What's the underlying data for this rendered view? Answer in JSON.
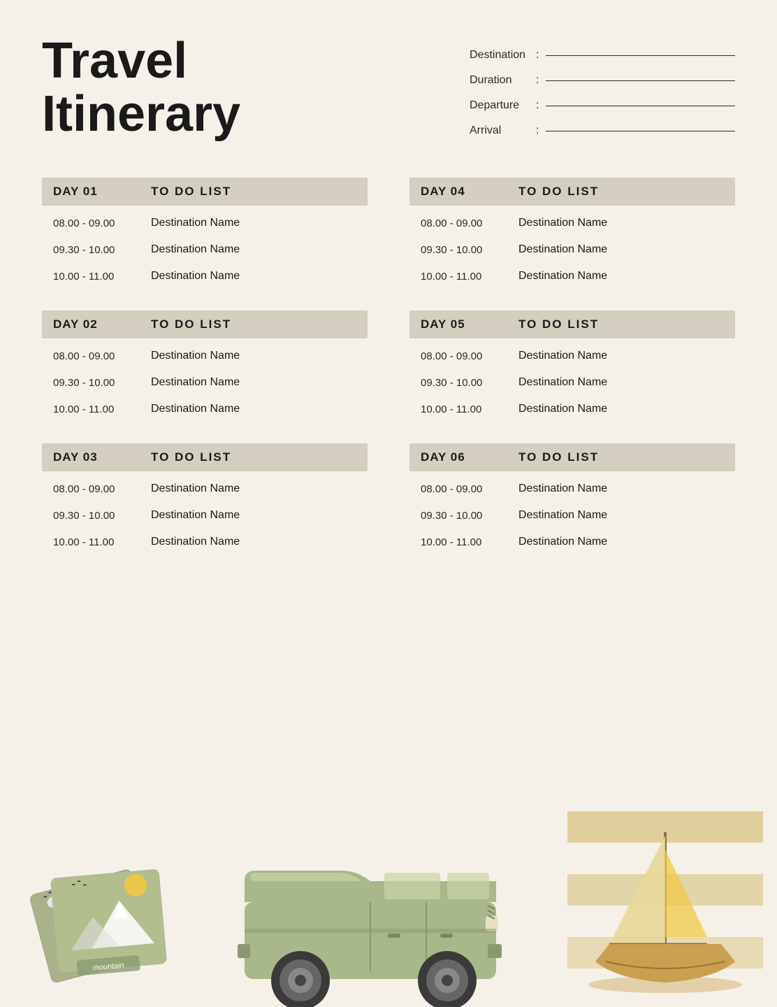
{
  "header": {
    "title_line1": "Travel",
    "title_line2": "Itinerary",
    "fields": [
      {
        "label": "Destination",
        "value": ""
      },
      {
        "label": "Duration",
        "value": ""
      },
      {
        "label": "Departure",
        "value": ""
      },
      {
        "label": "Arrival",
        "value": ""
      }
    ]
  },
  "days": [
    {
      "id": "day01",
      "label": "DAY 01",
      "todo_label": "TO DO LIST",
      "items": [
        {
          "time": "08.00 - 09.00",
          "destination": "Destination Name"
        },
        {
          "time": "09.30 - 10.00",
          "destination": "Destination Name"
        },
        {
          "time": "10.00 - 11.00",
          "destination": "Destination Name"
        }
      ]
    },
    {
      "id": "day04",
      "label": "DAY 04",
      "todo_label": "TO DO LIST",
      "items": [
        {
          "time": "08.00 - 09.00",
          "destination": "Destination Name"
        },
        {
          "time": "09.30 - 10.00",
          "destination": "Destination Name"
        },
        {
          "time": "10.00 - 11.00",
          "destination": "Destination Name"
        }
      ]
    },
    {
      "id": "day02",
      "label": "DAY 02",
      "todo_label": "TO DO LIST",
      "items": [
        {
          "time": "08.00 - 09.00",
          "destination": "Destination Name"
        },
        {
          "time": "09.30 - 10.00",
          "destination": "Destination Name"
        },
        {
          "time": "10.00 - 11.00",
          "destination": "Destination Name"
        }
      ]
    },
    {
      "id": "day05",
      "label": "DAY 05",
      "todo_label": "TO DO LIST",
      "items": [
        {
          "time": "08.00 - 09.00",
          "destination": "Destination Name"
        },
        {
          "time": "09.30 - 10.00",
          "destination": "Destination Name"
        },
        {
          "time": "10.00 - 11.00",
          "destination": "Destination Name"
        }
      ]
    },
    {
      "id": "day03",
      "label": "DAY 03",
      "todo_label": "TO DO LIST",
      "items": [
        {
          "time": "08.00 - 09.00",
          "destination": "Destination Name"
        },
        {
          "time": "09.30 - 10.00",
          "destination": "Destination Name"
        },
        {
          "time": "10.00 - 11.00",
          "destination": "Destination Name"
        }
      ]
    },
    {
      "id": "day06",
      "label": "DAY 06",
      "todo_label": "TO DO LIST",
      "items": [
        {
          "time": "08.00 - 09.00",
          "destination": "Destination Name"
        },
        {
          "time": "09.30 - 10.00",
          "destination": "Destination Name"
        },
        {
          "time": "10.00 - 11.00",
          "destination": "Destination Name"
        }
      ]
    }
  ],
  "colors": {
    "background": "#f5f0e8",
    "header_bg": "#d4cfc0",
    "accent_green": "#8a9c70",
    "accent_tan": "#c9a84c",
    "text_dark": "#1a1a1a"
  }
}
